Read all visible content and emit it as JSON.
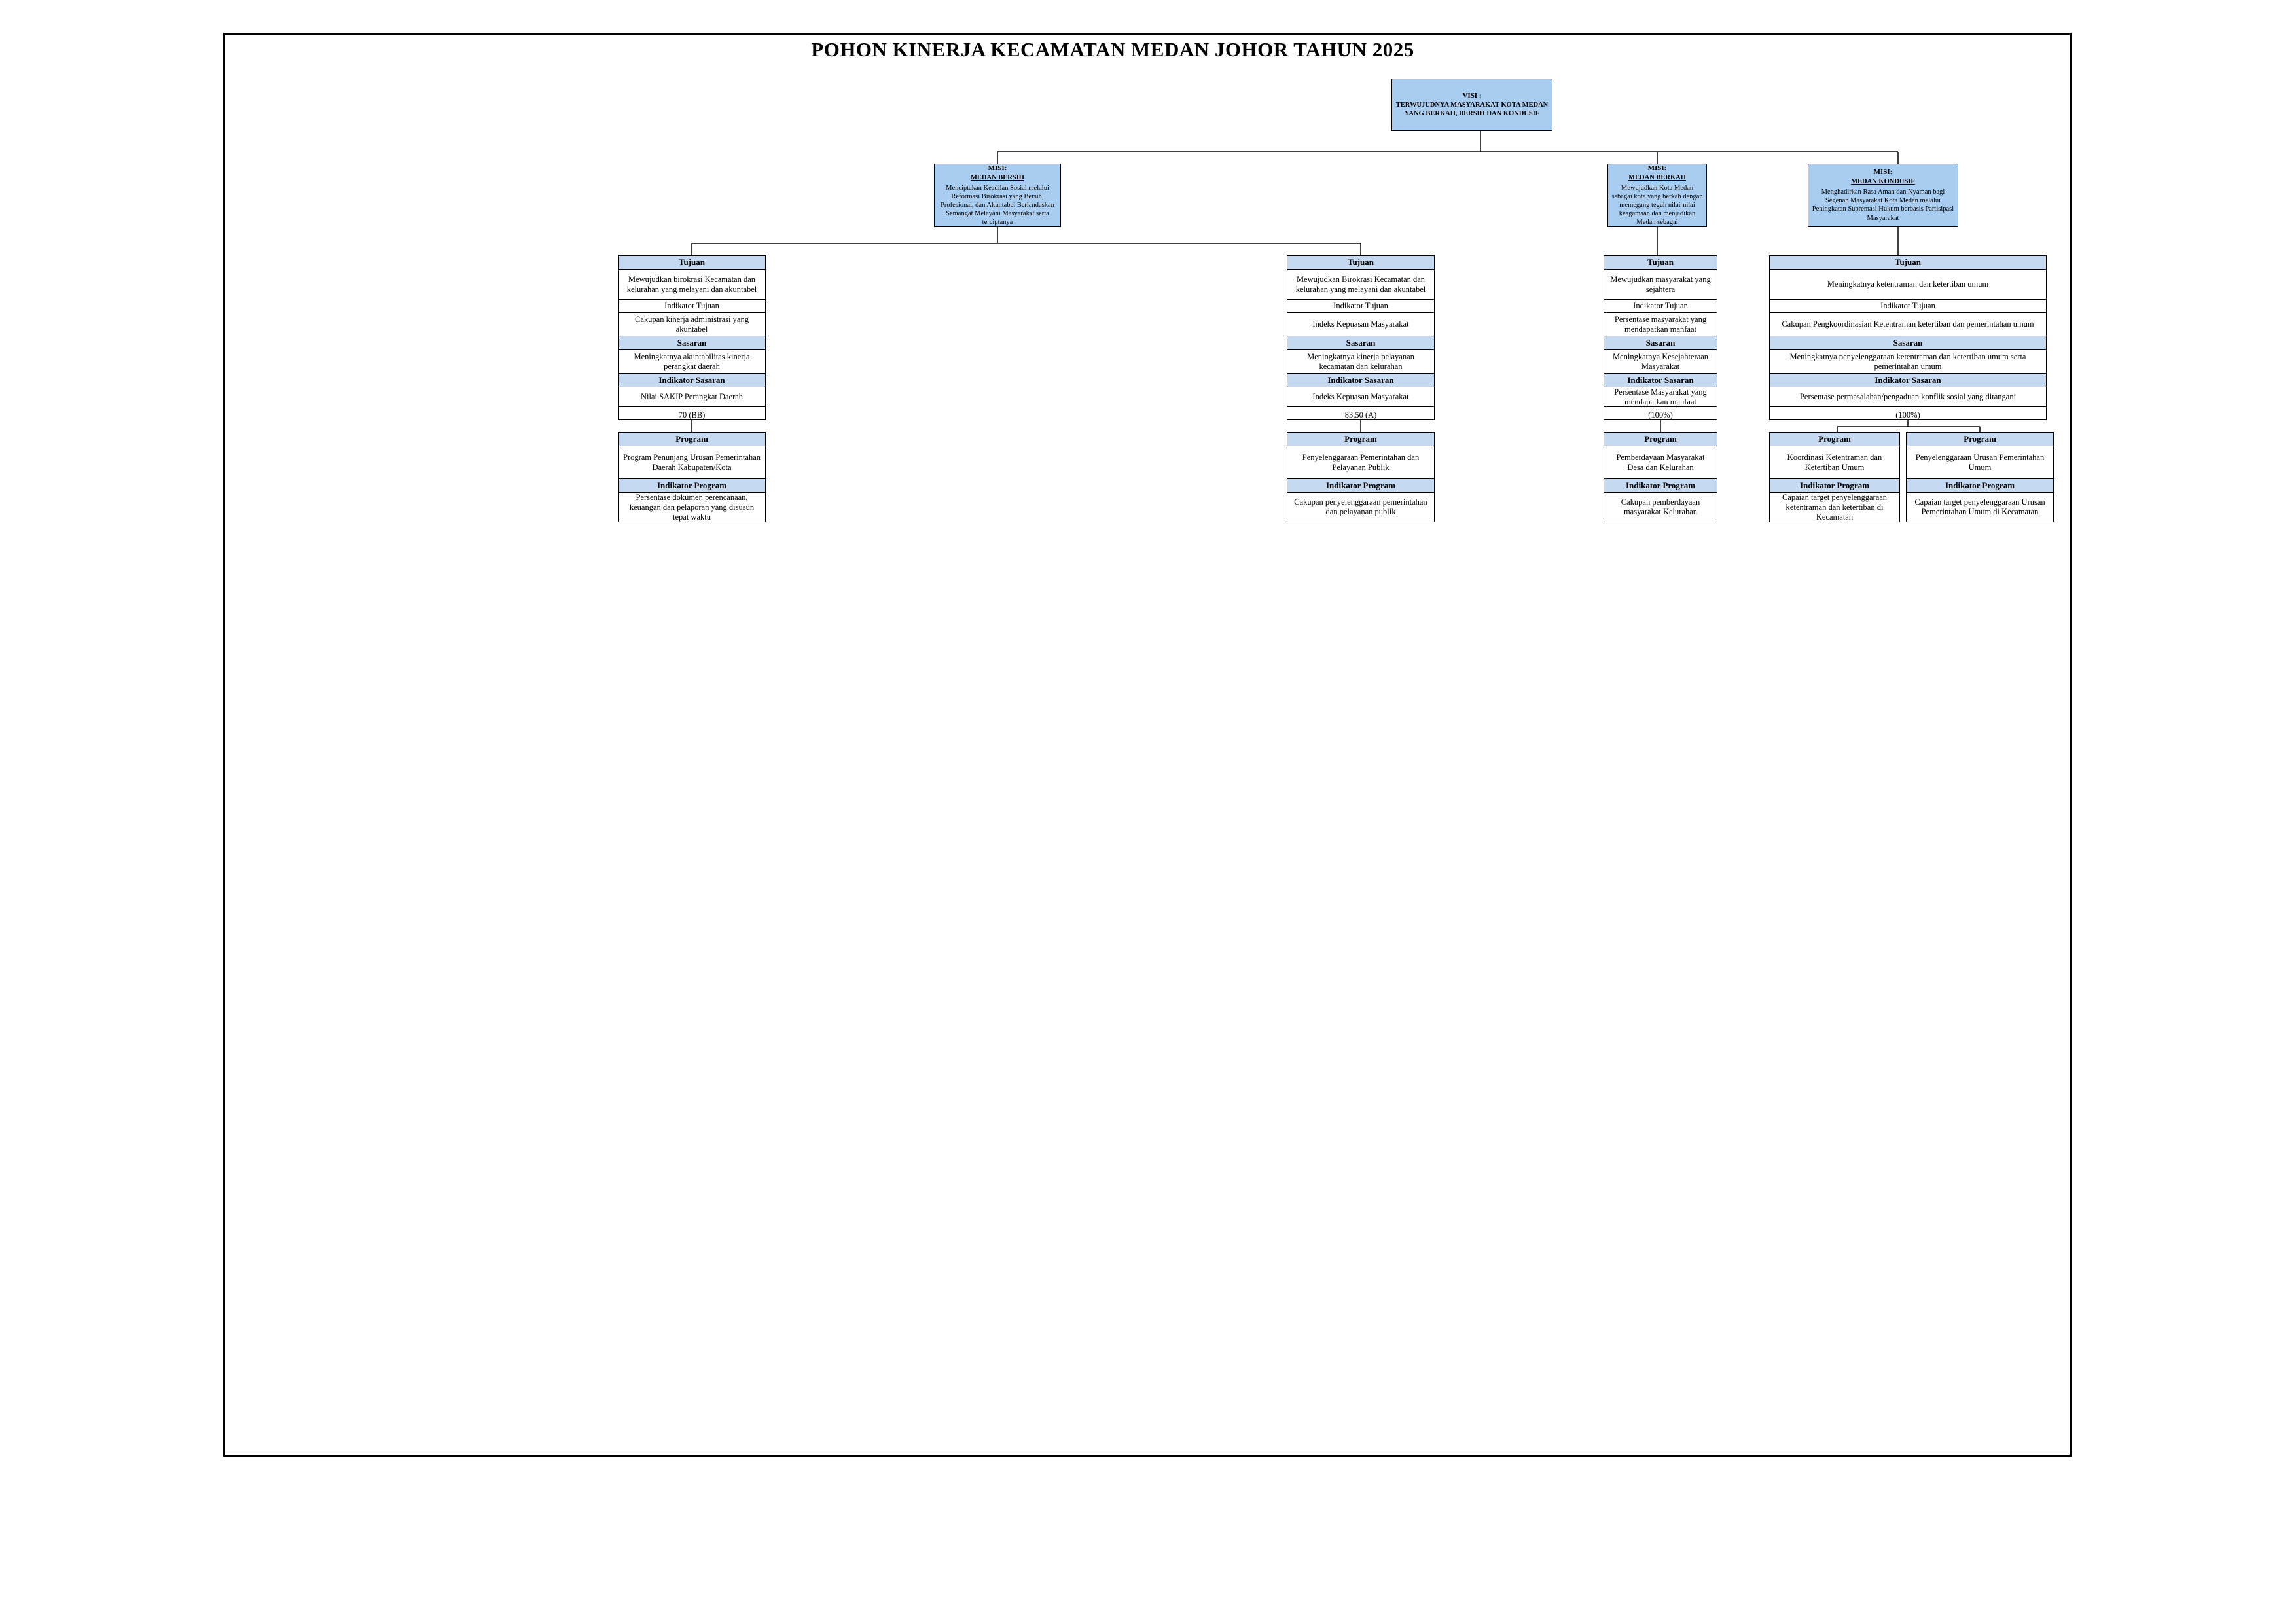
{
  "title": "POHON KINERJA KECAMATAN MEDAN JOHOR TAHUN 2025",
  "visi": {
    "label": "VISI :",
    "text": "TERWUJUDNYA MASYARAKAT KOTA MEDAN YANG BERKAH, BERSIH DAN KONDUSIF"
  },
  "misi": [
    {
      "label": "MISI:",
      "name": "MEDAN BERSIH",
      "text": "Menciptakan Keadilan Sosial melalui Reformasi Birokrasi yang Bersih, Profesional, dan Akuntabel Berlandaskan Semangat Melayani Masyarakat serta terciptanya"
    },
    {
      "label": "MISI:",
      "name": "MEDAN BERKAH",
      "text": "Mewujudkan Kota Medan sebagai kota yang berkah dengan memegang teguh nilai-nilai keagamaan dan menjadikan Medan sebagai"
    },
    {
      "label": "MISI:",
      "name": "MEDAN KONDUSIF",
      "text": "Menghadirkan Rasa Aman dan Nyaman bagi Segenap Masyarakat Kota Medan melalui Peningkatan Supremasi Hukum berbasis Partisipasi Masyarakat"
    }
  ],
  "tujuan": [
    {
      "header": "Tujuan",
      "text": "Mewujudkan birokrasi Kecamatan dan kelurahan yang melayani dan akuntabel",
      "ind_header": "Indikator Tujuan",
      "ind_text": "Cakupan kinerja administrasi yang akuntabel",
      "sasaran_header": "Sasaran",
      "sasaran_text": "Meningkatnya akuntabilitas kinerja perangkat daerah",
      "ind_sasaran_header": "Indikator Sasaran",
      "ind_sasaran_text": "Nilai SAKIP Perangkat Daerah",
      "target": "70 (BB)"
    },
    {
      "header": "Tujuan",
      "text": "Mewujudkan Birokrasi Kecamatan dan kelurahan yang melayani dan akuntabel",
      "ind_header": "Indikator Tujuan",
      "ind_text": "Indeks Kepuasan Masyarakat",
      "sasaran_header": "Sasaran",
      "sasaran_text": "Meningkatnya kinerja pelayanan kecamatan dan kelurahan",
      "ind_sasaran_header": "Indikator Sasaran",
      "ind_sasaran_text": "Indeks Kepuasan Masyarakat",
      "target": "83,50 (A)"
    },
    {
      "header": "Tujuan",
      "text": "Mewujudkan masyarakat yang sejahtera",
      "ind_header": "Indikator Tujuan",
      "ind_text": "Persentase masyarakat yang mendapatkan manfaat",
      "sasaran_header": "Sasaran",
      "sasaran_text": "Meningkatnya Kesejahteraan Masyarakat",
      "ind_sasaran_header": "Indikator Sasaran",
      "ind_sasaran_text": "Persentase Masyarakat yang mendapatkan manfaat",
      "target": "(100%)"
    },
    {
      "header": "Tujuan",
      "text": "Meningkatnya ketentraman dan ketertiban umum",
      "ind_header": "Indikator Tujuan",
      "ind_text": "Cakupan Pengkoordinasian Ketentraman ketertiban dan pemerintahan umum",
      "sasaran_header": "Sasaran",
      "sasaran_text": "Meningkatnya penyelenggaraan ketentraman dan ketertiban umum serta pemerintahan umum",
      "ind_sasaran_header": "Indikator Sasaran",
      "ind_sasaran_text": "Persentase permasalahan/pengaduan konflik sosial yang ditangani",
      "target": "(100%)"
    }
  ],
  "program": [
    {
      "header": "Program",
      "text": "Program Penunjang Urusan Pemerintahan Daerah Kabupaten/Kota",
      "ind_header": "Indikator Program",
      "ind_text": "Persentase dokumen perencanaan, keuangan dan pelaporan yang disusun tepat waktu"
    },
    {
      "header": "Program",
      "text": "Penyelenggaraan Pemerintahan dan Pelayanan Publik",
      "ind_header": "Indikator Program",
      "ind_text": "Cakupan penyelenggaraan pemerintahan dan pelayanan publik"
    },
    {
      "header": "Program",
      "text": "Pemberdayaan Masyarakat Desa dan Kelurahan",
      "ind_header": "Indikator Program",
      "ind_text": "Cakupan pemberdayaan masyarakat Kelurahan"
    },
    {
      "header": "Program",
      "text": "Koordinasi Ketentraman dan Ketertiban Umum",
      "ind_header": "Indikator Program",
      "ind_text": "Capaian target penyelenggaraan ketentraman dan ketertiban di Kecamatan"
    },
    {
      "header": "Program",
      "text": "Penyelenggaraan Urusan Pemerintahan Umum",
      "ind_header": "Indikator Program",
      "ind_text": "Capaian target penyelenggaraan Urusan Pemerintahan Umum di Kecamatan"
    }
  ]
}
